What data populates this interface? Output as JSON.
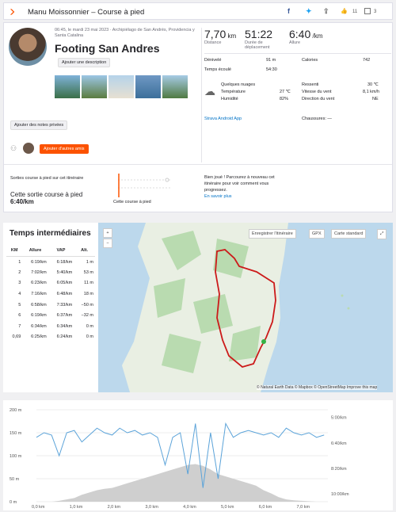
{
  "header": {
    "title": "Manu Moissonnier – Course à pied",
    "kudos": "11",
    "comments": "3"
  },
  "activity": {
    "meta": "06:45, le mardi 23 mai 2023 · Archipiélago de San Andrés, Providencia y Santa Catalina",
    "title": "Footing San Andres",
    "add_description": "Ajouter une description",
    "private_notes": "Ajouter des notes privées",
    "add_friends": "Ajouter d'autres amis",
    "stats": [
      {
        "value": "7,70",
        "unit": " km",
        "label": "Distance"
      },
      {
        "value": "51:22",
        "unit": "",
        "label": "Durée de déplacement"
      },
      {
        "value": "6:40",
        "unit": " /km",
        "label": "Allure"
      }
    ],
    "rows_left": [
      {
        "k": "Dénivelé",
        "v": "91 m"
      },
      {
        "k": "Temps écoulé",
        "v": "54:30"
      }
    ],
    "rows_right": [
      {
        "k": "Calories",
        "v": "742"
      }
    ],
    "weather": {
      "cond": "Quelques nuages",
      "temp_k": "Température",
      "temp_v": "27 ℃",
      "hum_k": "Humidité",
      "hum_v": "82%",
      "felt_k": "Ressenti",
      "felt_v": "30 ℃",
      "wind_k": "Vitesse du vent",
      "wind_v": "8,1 km/h",
      "dir_k": "Direction du vent",
      "dir_v": "NE"
    },
    "device": "Strava Android App",
    "shoes": "Chaussures: —",
    "route": {
      "line1": "Sorties course à pied sur cet itinéraire",
      "line2": "Cette sortie course à pied",
      "pace": "6:40/km",
      "chart_label": "Cette course à pied",
      "msg": "Bien joué ! Parcourez à nouveau cet itinéraire pour voir comment vous progressez.",
      "more": "En savoir plus"
    }
  },
  "splits": {
    "title": "Temps intermédiaires",
    "cols": [
      "KM",
      "Allure",
      "VAP",
      "Alt."
    ],
    "rows": [
      [
        "1",
        "6:19/km",
        "6:18/km",
        "1 m"
      ],
      [
        "2",
        "7:02/km",
        "5:40/km",
        "53 m"
      ],
      [
        "3",
        "6:23/km",
        "6:05/km",
        "11 m"
      ],
      [
        "4",
        "7:16/km",
        "6:48/km",
        "18 m"
      ],
      [
        "5",
        "6:58/km",
        "7:33/km",
        "−50 m"
      ],
      [
        "6",
        "6:19/km",
        "6:37/km",
        "−32 m"
      ],
      [
        "7",
        "6:34/km",
        "6:34/km",
        "0 m"
      ],
      [
        "0,69",
        "6:25/km",
        "6:24/km",
        "0 m"
      ]
    ]
  },
  "map": {
    "zoom_in": "+",
    "zoom_out": "−",
    "save": "Enregistrer l'itinéraire",
    "gpx": "GPX",
    "style": "Carte standard",
    "attribution": "© Natural Earth Data © Mapbox © OpenStreetMap Improve this map"
  },
  "chart_data": {
    "type": "line",
    "x": [
      0,
      0.2,
      0.4,
      0.6,
      0.8,
      1.0,
      1.2,
      1.4,
      1.6,
      1.8,
      2.0,
      2.2,
      2.4,
      2.6,
      2.8,
      3.0,
      3.2,
      3.4,
      3.6,
      3.8,
      4.0,
      4.2,
      4.4,
      4.6,
      4.8,
      5.0,
      5.2,
      5.4,
      5.6,
      5.8,
      6.0,
      6.2,
      6.4,
      6.6,
      6.8,
      7.0,
      7.2,
      7.4,
      7.6
    ],
    "xticks": [
      "0,0 km",
      "1,0 km",
      "2,0 km",
      "3,0 km",
      "4,0 km",
      "5,0 km",
      "6,0 km",
      "7,0 km"
    ],
    "yticks_left": [
      "0 m",
      "50 m",
      "100 m",
      "150 m",
      "200 m"
    ],
    "yticks_right": [
      "10:00/km",
      "8:20/km",
      "6:40/km",
      "5:00/km"
    ],
    "series": [
      {
        "values": [
          140,
          150,
          145,
          100,
          150,
          155,
          130,
          145,
          160,
          150,
          145,
          160,
          150,
          155,
          145,
          150,
          140,
          80,
          140,
          150,
          60,
          170,
          30,
          150,
          50,
          170,
          140,
          150,
          155,
          150,
          145,
          150,
          140,
          160,
          150,
          145,
          150,
          140,
          145
        ]
      },
      {
        "values": [
          0,
          0,
          0,
          2,
          5,
          8,
          15,
          20,
          25,
          28,
          30,
          35,
          40,
          45,
          50,
          55,
          60,
          65,
          70,
          75,
          80,
          82,
          78,
          70,
          60,
          55,
          50,
          45,
          40,
          35,
          25,
          18,
          10,
          5,
          3,
          2,
          1,
          0,
          0
        ]
      }
    ],
    "colors": {
      "pace": "#5ba3d9",
      "elev": "#cfcfcf"
    }
  }
}
